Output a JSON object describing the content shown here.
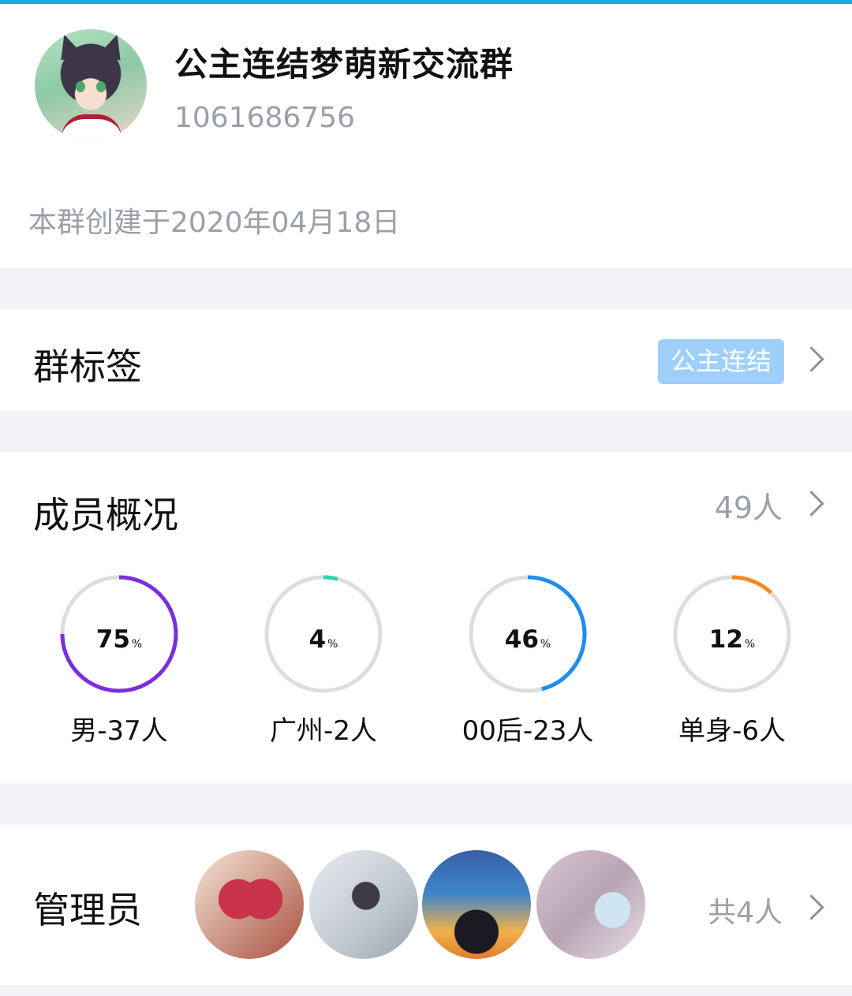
{
  "group": {
    "name": "公主连结梦萌新交流群",
    "id": "1061686756",
    "created": "本群创建于2020年04月18日"
  },
  "tags": {
    "title": "群标签",
    "tag": "公主连结",
    "tag_color": "#9fd0fb"
  },
  "members": {
    "title": "成员概况",
    "count": "49人",
    "stats": [
      {
        "percent_text": "75",
        "percent": 75,
        "label": "男-37人",
        "color": "#7a2fdc"
      },
      {
        "percent_text": "4",
        "percent": 4,
        "label": "广州-2人",
        "color": "#2ed3b5"
      },
      {
        "percent_text": "46",
        "percent": 46,
        "label": "00后-23人",
        "color": "#1f8ef0"
      },
      {
        "percent_text": "12",
        "percent": 12,
        "label": "单身-6人",
        "color": "#f48a1e"
      }
    ],
    "percent_unit": "%"
  },
  "admins": {
    "title": "管理员",
    "count": "共4人"
  },
  "icons": {
    "chevron": "chevron-right-icon"
  },
  "colors": {
    "top_accent": "#1aa7e8",
    "ring_track": "#dddddd"
  }
}
